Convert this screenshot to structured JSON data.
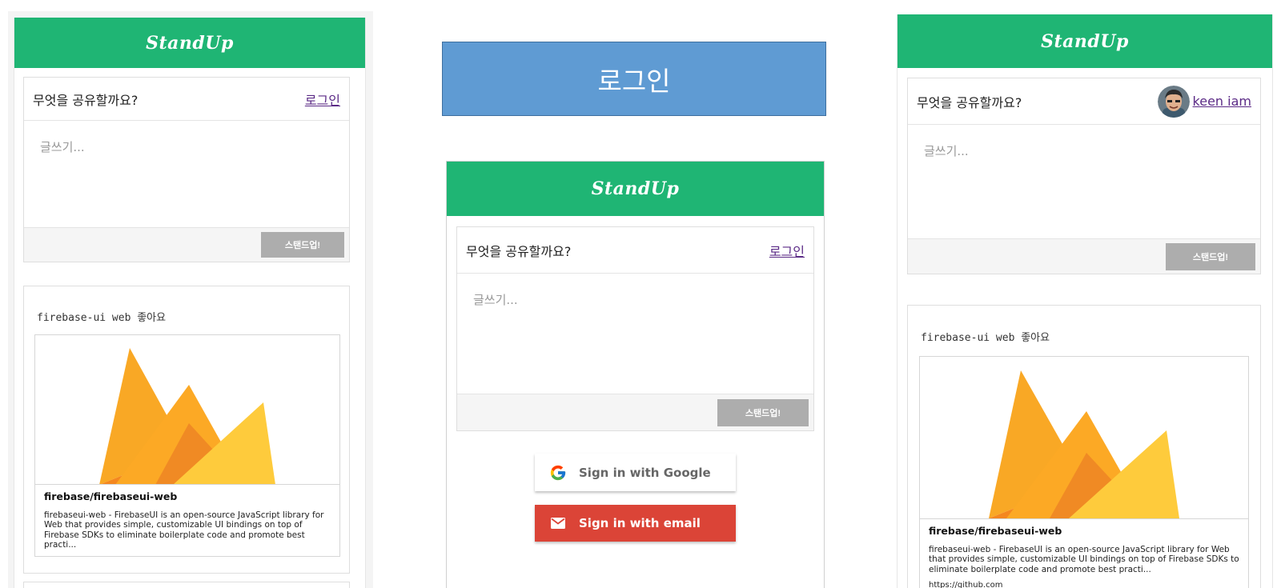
{
  "app": {
    "brand": "StandUp"
  },
  "composer": {
    "prompt": "무엇을 공유할까요?",
    "login_link": "로그인",
    "placeholder": "글쓰기...",
    "submit_label": "스탠드업!"
  },
  "post": {
    "text": "firebase-ui web 좋아요",
    "card": {
      "title": "firebase/firebaseui-web",
      "description": "firebaseui-web - FirebaseUI is an open-source JavaScript library for Web that provides simple, customizable UI bindings on top of Firebase SDKs to eliminate boilerplate code and promote best practi...",
      "url": "https://github.com"
    }
  },
  "login_banner": {
    "label": "로그인"
  },
  "signin": {
    "google_label": "Sign in with Google",
    "email_label": "Sign in with email"
  },
  "user": {
    "name": "keen iam"
  },
  "colors": {
    "brand_green": "#1fb574",
    "banner_blue": "#5f9bd3",
    "email_red": "#db4437",
    "button_grey": "#adadad"
  },
  "icons": [
    "firebase-logo",
    "google-g-icon",
    "mail-icon",
    "avatar"
  ]
}
